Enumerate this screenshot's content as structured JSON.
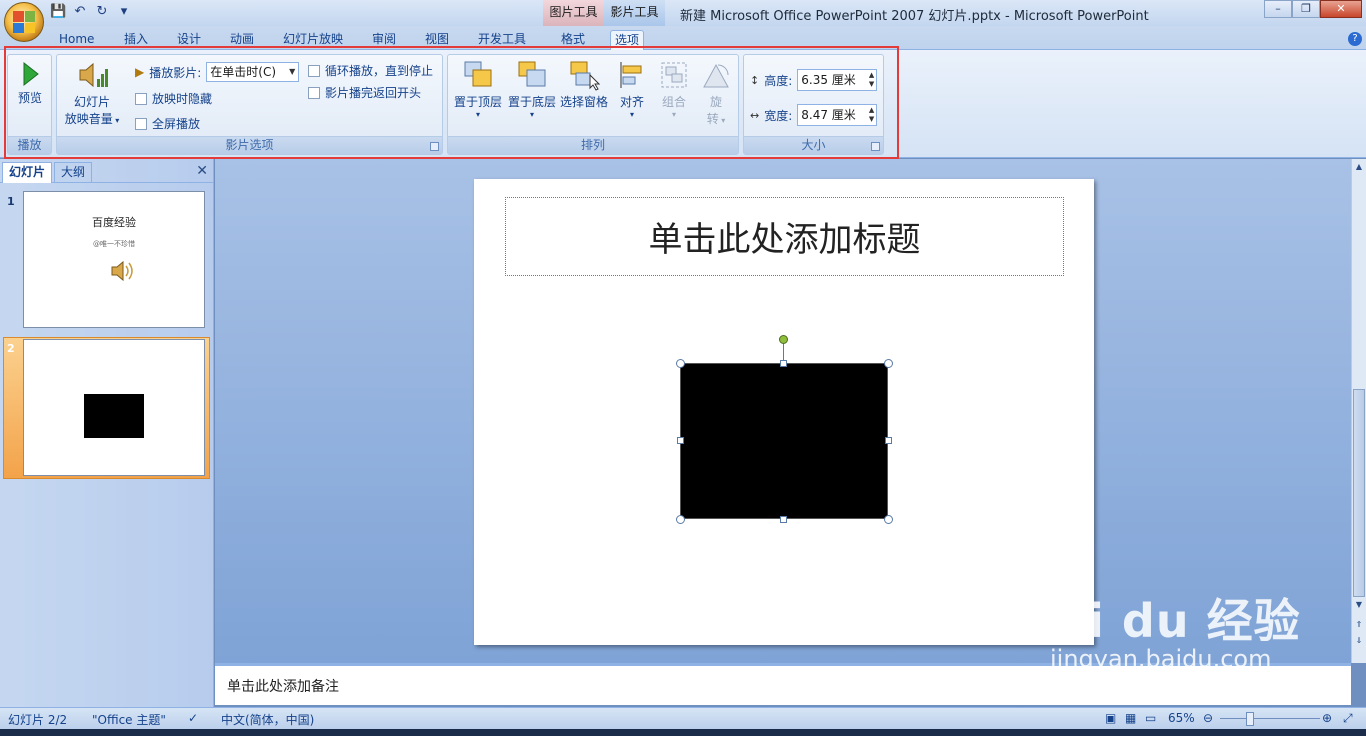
{
  "window": {
    "title": "新建 Microsoft Office PowerPoint 2007 幻灯片.pptx - Microsoft PowerPoint",
    "context_tabs": [
      "图片工具",
      "影片工具"
    ],
    "controls": [
      "–",
      "❐",
      "✕"
    ]
  },
  "ribbon": {
    "tabs": [
      "Home",
      "插入",
      "设计",
      "动画",
      "幻灯片放映",
      "审阅",
      "视图",
      "开发工具",
      "格式",
      "选项"
    ],
    "active_tab": "选项",
    "groups": {
      "play": {
        "label": "播放",
        "preview": "预览"
      },
      "movie_options": {
        "label": "影片选项",
        "volume_line1": "幻灯片",
        "volume_line2": "放映音量",
        "play_movie_label": "播放影片:",
        "play_movie_value": "在单击时(C)",
        "hide_while_not_playing": "放映时隐藏",
        "fullscreen": "全屏播放",
        "loop": "循环播放，直到停止",
        "rewind": "影片播完返回开头"
      },
      "arrange": {
        "label": "排列",
        "bring_front": "置于顶层",
        "send_back": "置于底层",
        "selection_pane": "选择窗格",
        "align": "对齐",
        "group": "组合",
        "rotate_line1": "旋",
        "rotate_line2": "转"
      },
      "size": {
        "label": "大小",
        "height_label": "高度:",
        "height_value": "6.35 厘米",
        "width_label": "宽度:",
        "width_value": "8.47 厘米"
      }
    }
  },
  "left_pane": {
    "tabs": [
      "幻灯片",
      "大纲"
    ],
    "slides": [
      {
        "number": "1",
        "title": "百度经验",
        "subtitle": "@唯一不珍惜"
      },
      {
        "number": "2"
      }
    ]
  },
  "slide": {
    "title_placeholder": "单击此处添加标题"
  },
  "notes": {
    "placeholder": "单击此处添加备注"
  },
  "status": {
    "slide_info": "幻灯片 2/2",
    "theme": "\"Office 主题\"",
    "language": "中文(简体，中国)",
    "zoom": "65%"
  },
  "watermark": {
    "brand": "Bai du 经验",
    "url": "jingyan.baidu.com"
  }
}
